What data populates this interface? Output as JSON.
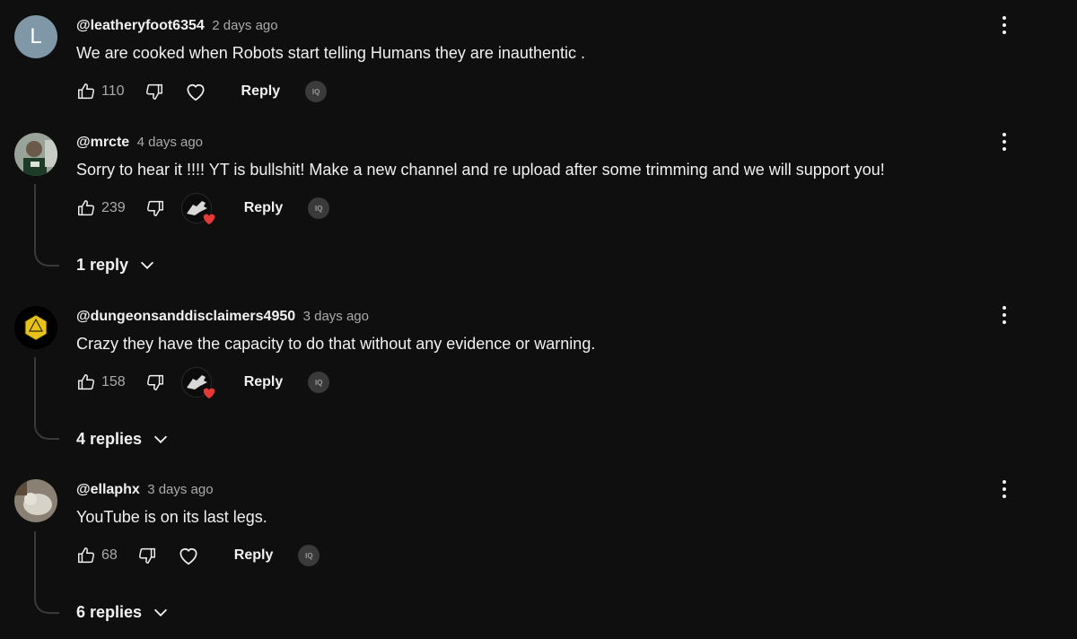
{
  "comments": [
    {
      "author": "@leatheryfoot6354",
      "time": "2 days ago",
      "text": "We are cooked when Robots start telling Humans they are inauthentic .",
      "likes": "110",
      "avatar_letter": "L",
      "avatar_color": "#7f97a6",
      "reply_label": "Reply",
      "iq_label": "IQ"
    },
    {
      "author": "@mrcte",
      "time": "4 days ago",
      "text": "Sorry to hear it !!!! YT is bullshit! Make a new channel and re upload after some trimming and we will support you!",
      "likes": "239",
      "reply_label": "Reply",
      "iq_label": "IQ",
      "replies_label": "1 reply"
    },
    {
      "author": "@dungeonsanddisclaimers4950",
      "time": "3 days ago",
      "text": "Crazy they have the capacity to do that without any evidence or warning.",
      "likes": "158",
      "reply_label": "Reply",
      "iq_label": "IQ",
      "replies_label": "4 replies"
    },
    {
      "author": "@ellaphx",
      "time": "3 days ago",
      "text": "YouTube is on its last legs.",
      "likes": "68",
      "reply_label": "Reply",
      "iq_label": "IQ",
      "replies_label": "6 replies"
    }
  ],
  "colors": {
    "background": "#0f0f0f",
    "text": "#f1f1f1",
    "secondary_text": "#aaaaaa",
    "heart_red": "#e53935"
  }
}
